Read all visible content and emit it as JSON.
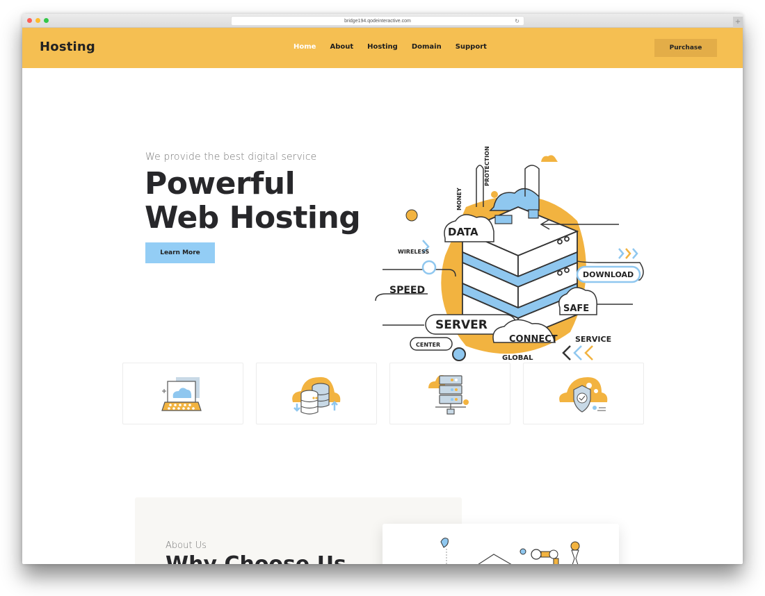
{
  "browser": {
    "url": "bridge194.qodeinteractive.com",
    "reload_icon": "↻",
    "new_tab_icon": "+"
  },
  "header": {
    "logo": "Hosting",
    "nav": [
      {
        "label": "Home",
        "active": true
      },
      {
        "label": "About",
        "active": false
      },
      {
        "label": "Hosting",
        "active": false
      },
      {
        "label": "Domain",
        "active": false
      },
      {
        "label": "Support",
        "active": false
      }
    ],
    "purchase_label": "Purchase"
  },
  "hero": {
    "subtitle": "We provide the best digital service",
    "title_line1": "Powerful",
    "title_line2": "Web Hosting",
    "cta_label": "Learn More",
    "illustration_labels": {
      "data": "DATA",
      "money": "MONEY",
      "protection": "PROTECTION",
      "wireless": "WIRELESS",
      "speed": "SPEED",
      "download": "DOWNLOAD",
      "safe": "SAFE",
      "server": "SERVER",
      "connect": "CONNECT",
      "service": "SERVICE",
      "center": "CENTER",
      "global": "GLOBAL"
    }
  },
  "features": [
    {
      "icon": "laptop-cloud-icon"
    },
    {
      "icon": "database-cloud-icon"
    },
    {
      "icon": "server-rack-icon"
    },
    {
      "icon": "shield-check-icon"
    }
  ],
  "about": {
    "label": "About Us",
    "title": "Why Choose Us"
  },
  "colors": {
    "brand_yellow": "#f5bf52",
    "purchase_bg": "#e3ad48",
    "cta_blue": "#93cdf5",
    "heading_dark": "#27272a",
    "illus_blue": "#8fc7ef",
    "illus_orange": "#f2b340"
  }
}
